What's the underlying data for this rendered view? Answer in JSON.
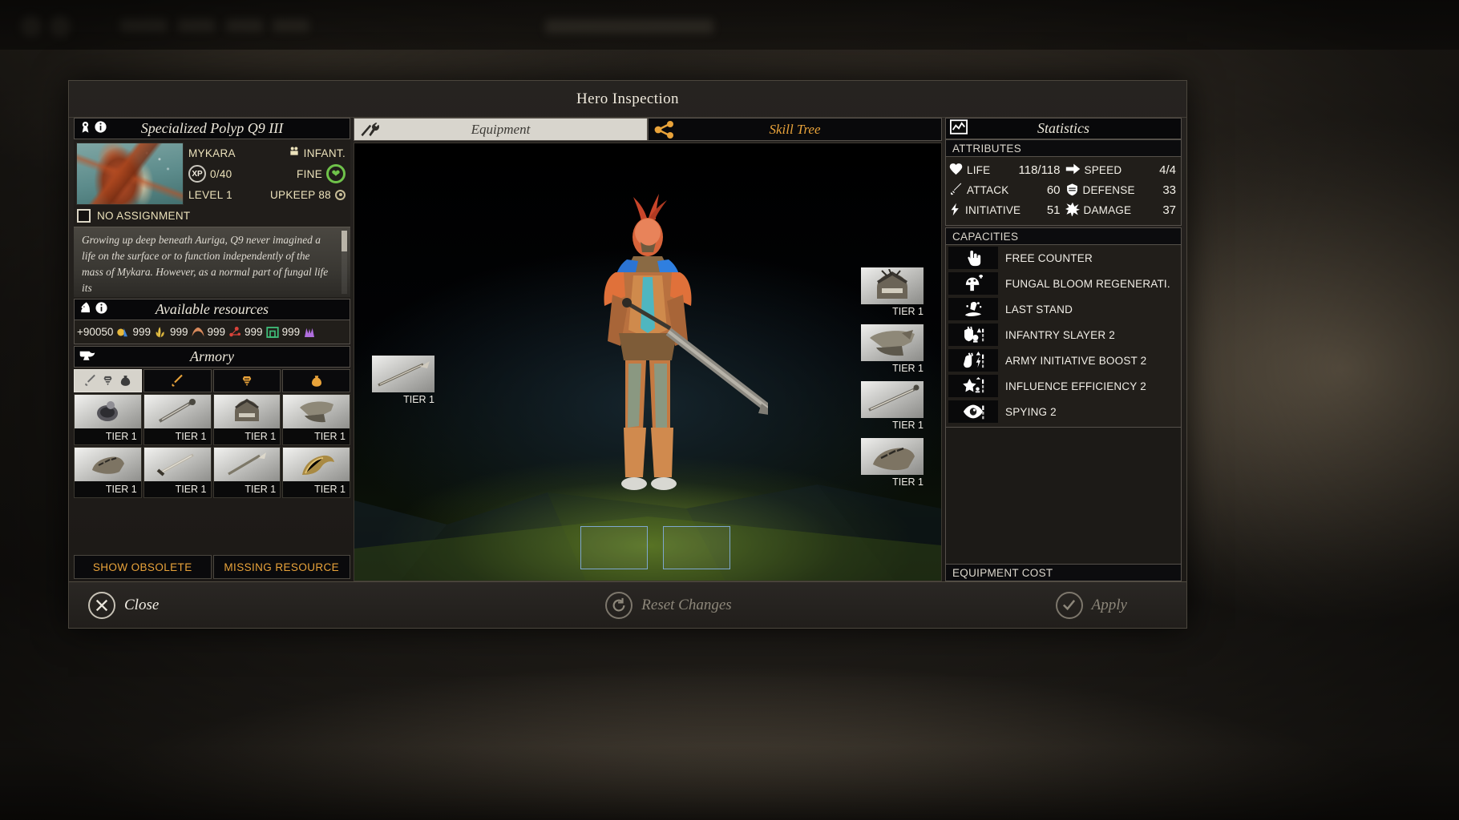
{
  "window": {
    "title": "Hero Inspection"
  },
  "hero": {
    "name": "Specialized Polyp Q9 III",
    "faction": "MYKARA",
    "unit_type": "INFANT.",
    "xp_badge": "XP",
    "xp": "0/40",
    "quality": "FINE",
    "level": "LEVEL 1",
    "upkeep": "UPKEEP 88",
    "assignment_label": "NO ASSIGNMENT",
    "description": "Growing up deep beneath Auriga, Q9 never imagined a life on the surface or to function independently of the mass of Mykara. However, as a normal part of fungal life its"
  },
  "resources": {
    "title": "Available resources",
    "items": [
      {
        "icon": "dust-icon",
        "value": "+90050",
        "color": "#e8b93c"
      },
      {
        "icon": "food-icon",
        "value": "999",
        "color": "#e6c24a"
      },
      {
        "icon": "industry-icon",
        "value": "999",
        "color": "#d98a5c"
      },
      {
        "icon": "science-icon",
        "value": "999",
        "color": "#d8433a"
      },
      {
        "icon": "influence-icon",
        "value": "999",
        "color": "#3fbf7a"
      },
      {
        "icon": "strategic-icon",
        "value": "999",
        "color": "#b06ede"
      }
    ]
  },
  "armory": {
    "title": "Armory",
    "tabs": [
      {
        "name": "all",
        "icons": [
          "sword-icon",
          "armor-icon",
          "pouch-icon"
        ],
        "active": true
      },
      {
        "name": "weapon",
        "icons": [
          "sword-icon"
        ],
        "active": false
      },
      {
        "name": "armor",
        "icons": [
          "armor-icon"
        ],
        "active": false
      },
      {
        "name": "misc",
        "icons": [
          "pouch-icon"
        ],
        "active": false
      }
    ],
    "items": [
      {
        "icon": "ring-item",
        "tier": "TIER 1"
      },
      {
        "icon": "staff-item",
        "tier": "TIER 1"
      },
      {
        "icon": "helmet-item",
        "tier": "TIER 1"
      },
      {
        "icon": "pauldron-item",
        "tier": "TIER 1"
      },
      {
        "icon": "gauntlet-item",
        "tier": "TIER 1"
      },
      {
        "icon": "sword-item",
        "tier": "TIER 1"
      },
      {
        "icon": "spear-item",
        "tier": "TIER 1"
      },
      {
        "icon": "horn-item",
        "tier": "TIER 1"
      }
    ],
    "buttons": [
      {
        "name": "show-obsolete",
        "label": "SHOW OBSOLETE"
      },
      {
        "name": "missing-resource",
        "label": "MISSING RESOURCE"
      }
    ]
  },
  "tabs": [
    {
      "name": "equipment",
      "label": "Equipment",
      "icon": "tools-icon",
      "active": true
    },
    {
      "name": "skill-tree",
      "label": "Skill Tree",
      "icon": "branch-icon",
      "active": false
    }
  ],
  "equipment_slots": {
    "left": [
      {
        "name": "weapon-slot",
        "icon": "spear-item",
        "tier": "TIER 1"
      }
    ],
    "right": [
      {
        "name": "helmet-slot",
        "icon": "helmet-item",
        "tier": "TIER 1"
      },
      {
        "name": "pauldron-slot",
        "icon": "pauldron-item",
        "tier": "TIER 1"
      },
      {
        "name": "staff-slot",
        "icon": "staff-item",
        "tier": "TIER 1"
      },
      {
        "name": "gauntlet-slot",
        "icon": "gauntlet-item",
        "tier": "TIER 1"
      }
    ],
    "bottom": [
      {
        "name": "boot-slot-left",
        "icon": "empty-slot",
        "tier": ""
      },
      {
        "name": "boot-slot-right",
        "icon": "empty-slot",
        "tier": ""
      }
    ]
  },
  "statistics": {
    "title": "Statistics",
    "icon": "chart-icon",
    "attributes_header": "ATTRIBUTES",
    "attributes": [
      {
        "icon": "heart-icon",
        "name": "LIFE",
        "value": "118/118"
      },
      {
        "icon": "arrow-icon",
        "name": "SPEED",
        "value": "4/4"
      },
      {
        "icon": "sword-icon",
        "name": "ATTACK",
        "value": "60"
      },
      {
        "icon": "shield-icon",
        "name": "DEFENSE",
        "value": "33"
      },
      {
        "icon": "lightning-icon",
        "name": "INITIATIVE",
        "value": "51"
      },
      {
        "icon": "burst-icon",
        "name": "DAMAGE",
        "value": "37"
      }
    ],
    "capacities_header": "CAPACITIES",
    "capacities": [
      {
        "icon": "hand-pointer-icon",
        "name": "FREE COUNTER"
      },
      {
        "icon": "fungal-bloom-icon",
        "name": "FUNGAL BLOOM REGENERATI."
      },
      {
        "icon": "last-stand-icon",
        "name": "LAST STAND"
      },
      {
        "icon": "infantry-slayer-icon",
        "name": "INFANTRY SLAYER 2"
      },
      {
        "icon": "army-initiative-icon",
        "name": "ARMY INITIATIVE BOOST 2"
      },
      {
        "icon": "influence-star-icon",
        "name": "INFLUENCE EFFICIENCY 2"
      },
      {
        "icon": "eye-icon",
        "name": "SPYING 2"
      }
    ],
    "equipment_cost_header": "EQUIPMENT COST"
  },
  "footer": {
    "close": "Close",
    "reset": "Reset Changes",
    "apply": "Apply"
  },
  "colors": {
    "accent_gold": "#e9a33a",
    "text_cream": "#ece2bb",
    "health_green": "#6fc24a"
  }
}
